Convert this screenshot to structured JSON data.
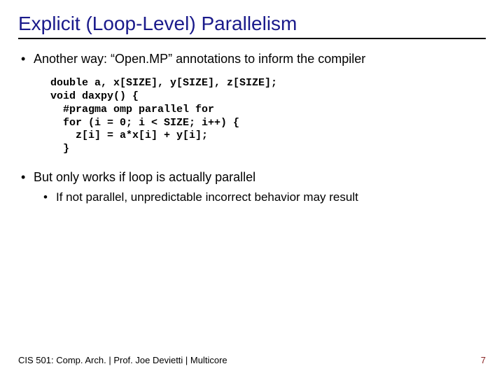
{
  "title": "Explicit (Loop-Level) Parallelism",
  "bullets": {
    "b1": "Another way: “Open.MP” annotations to inform the compiler",
    "b2": "But only works if loop is actually parallel",
    "b2_sub1": "If not parallel, unpredictable incorrect behavior may result"
  },
  "code": "double a, x[SIZE], y[SIZE], z[SIZE];\nvoid daxpy() {\n  #pragma omp parallel for\n  for (i = 0; i < SIZE; i++) {\n    z[i] = a*x[i] + y[i];\n  }",
  "footer": {
    "left": "CIS 501: Comp. Arch.  |  Prof. Joe Devietti  |  Multicore",
    "page": "7"
  }
}
